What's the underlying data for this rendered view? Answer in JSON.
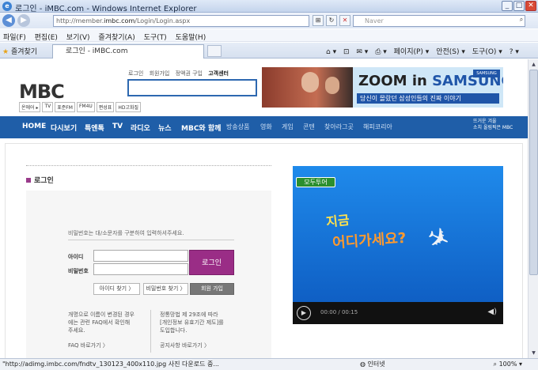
{
  "window": {
    "title": "로그인 - iMBC.com - Windows Internet Explorer",
    "minimize": "_",
    "maximize": "□",
    "close": "✕"
  },
  "address": {
    "prefix": "http://member.",
    "domain": "imbc.com",
    "path": "/Login/Login.aspx",
    "search_placeholder": "Naver"
  },
  "menu": [
    "파일(F)",
    "편집(E)",
    "보기(V)",
    "즐겨찾기(A)",
    "도구(T)",
    "도움말(H)"
  ],
  "tabbar": {
    "favorites": "즐겨찾기",
    "tab_title": "로그인 - iMBC.com",
    "commands": [
      "페이지(P) ▾",
      "안전(S) ▾",
      "도구(O) ▾"
    ]
  },
  "site": {
    "logo": "MBC",
    "top_links": [
      "로그인",
      "회원가입",
      "정액권 구입",
      "고객센터"
    ],
    "channels": [
      "온에어 ▸",
      "TV",
      "표준FM",
      "FM4U",
      "편성표",
      "HD고화질"
    ],
    "ad": {
      "headline_a": "ZOOM in ",
      "headline_b": "SAMSUNG",
      "sub": "당신이 몰랐던 삼성인들의 진짜 이야기",
      "brand": "SAMSUNG"
    },
    "nav_main": [
      "HOME",
      "다시보기",
      "특엔톡",
      "TV",
      "라디오",
      "뉴스",
      "MBC와 함께"
    ],
    "nav_sub": [
      "방송상품",
      "영화",
      "게임",
      "콘텐",
      "찾아라그곳",
      "해피코리아"
    ],
    "nav_right": [
      "뜨거운 겨울",
      "소치 올림픽은 MBC"
    ]
  },
  "login": {
    "title": "로그인",
    "hint": "비밀번호는 대/소문자를 구분하여 입력하셔주세요.",
    "id_label": "아이디",
    "pw_label": "비밀번호",
    "login_button": "로그인",
    "find_id": "아이디 찾기 〉",
    "find_pw": "비밀번호 찾기 〉",
    "join": "회원 가입",
    "note_left_1": "개명으로 이름이 변경된 경우",
    "note_left_2": "에는 관련 FAQ에서 확인해",
    "note_left_3": "주세요.",
    "faq_link": "FAQ 바로가기 〉",
    "note_right_1": "정통망법 제 29조에 따라",
    "note_right_2": "[개인정보 유효기간 제도]를",
    "note_right_3": "도입합니다.",
    "notice_link": "공지사항 바로가기 〉"
  },
  "video": {
    "badge": "모두투어",
    "line1": "지금",
    "line2": "어디가세요?",
    "time": "00:00 / 00:15"
  },
  "status": {
    "text": "\"http://adimg.imbc.com/fndtv_130123_400x110.jpg 사진 다운로드 중...",
    "zone": "인터넷",
    "zoom": "100%"
  }
}
